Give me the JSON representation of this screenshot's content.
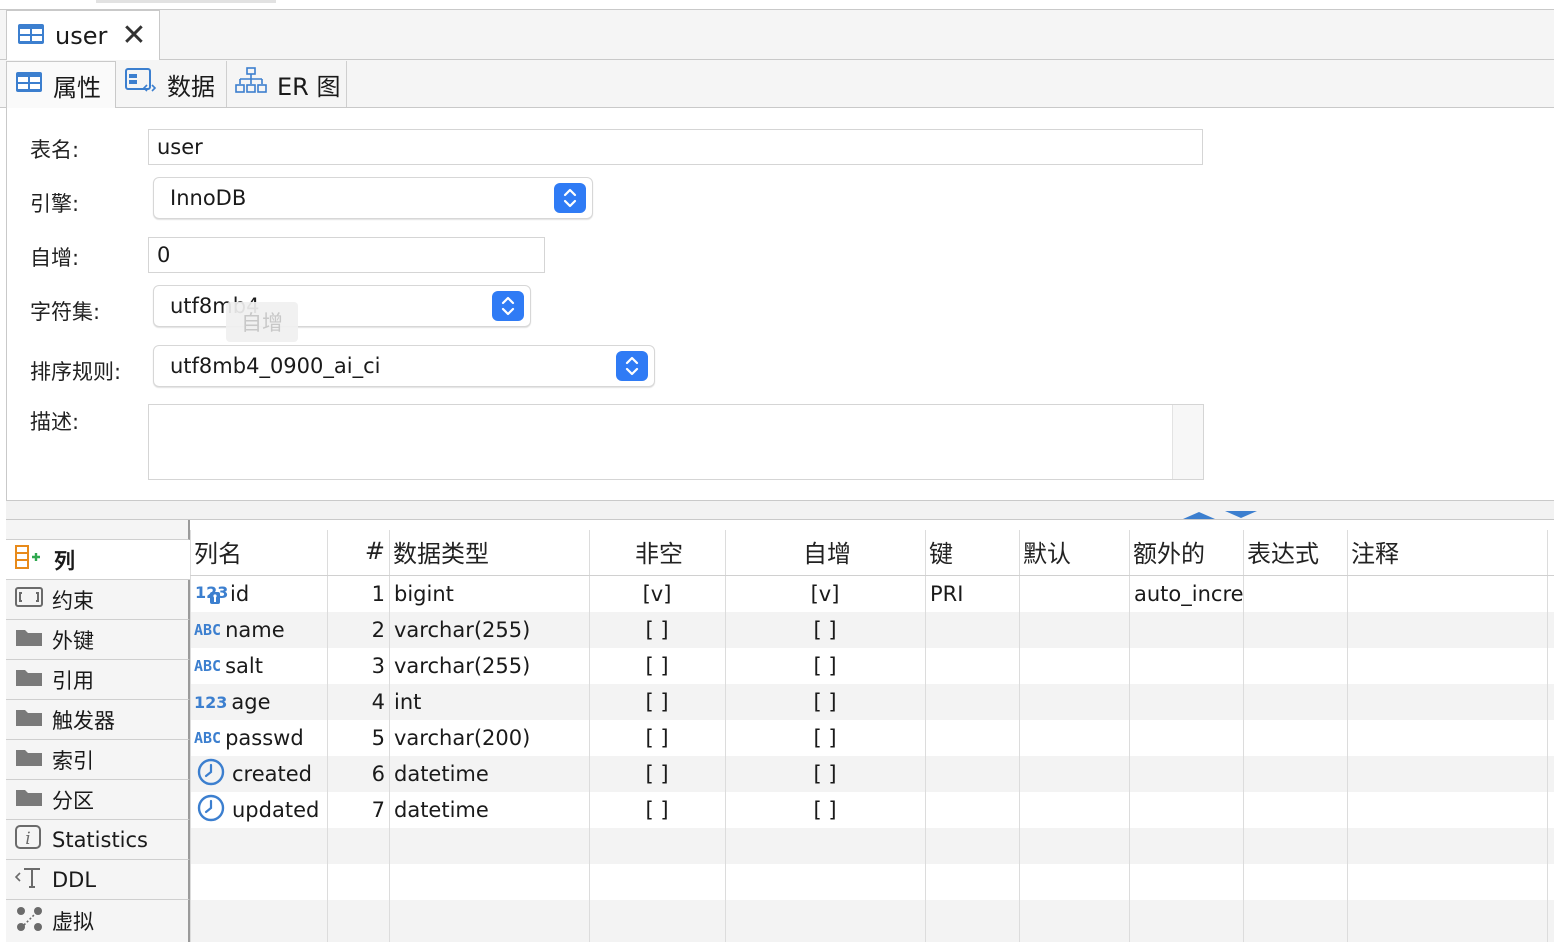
{
  "editor_tab": {
    "title": "user"
  },
  "sub_tabs": [
    {
      "label": "属性"
    },
    {
      "label": "数据"
    },
    {
      "label": "ER 图"
    }
  ],
  "properties": {
    "table_name_label": "表名:",
    "table_name_value": "user",
    "engine_label": "引擎:",
    "engine_value": "InnoDB",
    "auto_inc_label": "自增:",
    "auto_inc_value": "0",
    "charset_label": "字符集:",
    "charset_value": "utf8mb4",
    "collation_label": "排序规则:",
    "collation_value": "utf8mb4_0900_ai_ci",
    "description_label": "描述:",
    "description_value": "",
    "tooltip": "自增"
  },
  "side_nav": [
    {
      "label": "列",
      "icon": "column-add-icon"
    },
    {
      "label": "约束",
      "icon": "constraint-icon"
    },
    {
      "label": "外键",
      "icon": "folder-icon"
    },
    {
      "label": "引用",
      "icon": "folder-icon"
    },
    {
      "label": "触发器",
      "icon": "folder-icon"
    },
    {
      "label": "索引",
      "icon": "folder-icon"
    },
    {
      "label": "分区",
      "icon": "folder-icon"
    },
    {
      "label": "Statistics",
      "icon": "info-icon"
    },
    {
      "label": "DDL",
      "icon": "ddl-icon"
    },
    {
      "label": "虚拟",
      "icon": "virtual-icon"
    }
  ],
  "columns_table": {
    "headers": [
      "列名",
      "#",
      "数据类型",
      "非空",
      "自增",
      "键",
      "默认",
      "额外的",
      "表达式",
      "注释"
    ],
    "rows": [
      {
        "type_icon": "123",
        "name": "id",
        "num": "1",
        "type": "bigint",
        "not_null": "[v]",
        "auto_inc": "[v]",
        "key": "PRI",
        "default": "",
        "extra": "auto_incre",
        "expr": "",
        "comment": ""
      },
      {
        "type_icon": "ABC",
        "name": "name",
        "num": "2",
        "type": "varchar(255)",
        "not_null": "[ ]",
        "auto_inc": "[ ]",
        "key": "",
        "default": "",
        "extra": "",
        "expr": "",
        "comment": ""
      },
      {
        "type_icon": "ABC",
        "name": "salt",
        "num": "3",
        "type": "varchar(255)",
        "not_null": "[ ]",
        "auto_inc": "[ ]",
        "key": "",
        "default": "",
        "extra": "",
        "expr": "",
        "comment": ""
      },
      {
        "type_icon": "123",
        "name": "age",
        "num": "4",
        "type": "int",
        "not_null": "[ ]",
        "auto_inc": "[ ]",
        "key": "",
        "default": "",
        "extra": "",
        "expr": "",
        "comment": ""
      },
      {
        "type_icon": "ABC",
        "name": "passwd",
        "num": "5",
        "type": "varchar(200)",
        "not_null": "[ ]",
        "auto_inc": "[ ]",
        "key": "",
        "default": "",
        "extra": "",
        "expr": "",
        "comment": ""
      },
      {
        "type_icon": "clock",
        "name": "created",
        "num": "6",
        "type": "datetime",
        "not_null": "[ ]",
        "auto_inc": "[ ]",
        "key": "",
        "default": "",
        "extra": "",
        "expr": "",
        "comment": ""
      },
      {
        "type_icon": "clock",
        "name": "updated",
        "num": "7",
        "type": "datetime",
        "not_null": "[ ]",
        "auto_inc": "[ ]",
        "key": "",
        "default": "",
        "extra": "",
        "expr": "",
        "comment": ""
      }
    ]
  },
  "colors": {
    "accent": "#2f7bf5",
    "icon_blue": "#3c7fcf",
    "row_alt": "#f3f3f3"
  }
}
